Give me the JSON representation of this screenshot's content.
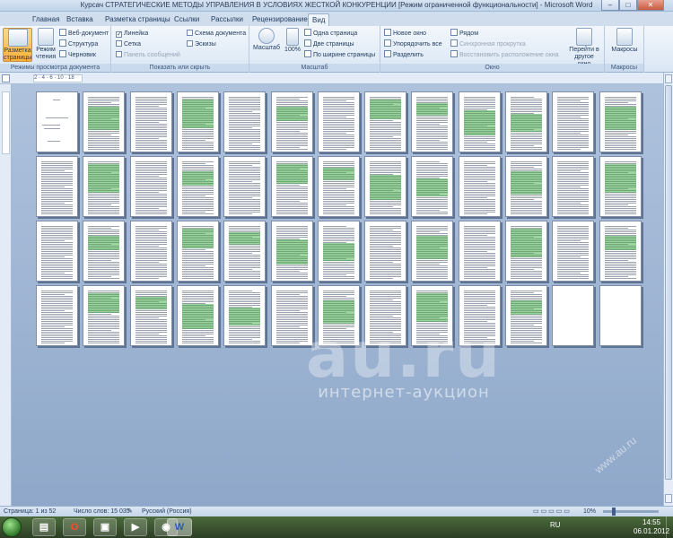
{
  "window": {
    "title": "Курсач СТРАТЕГИЧЕСКИЕ МЕТОДЫ УПРАВЛЕНИЯ В УСЛОВИЯХ ЖЕСТКОЙ КОНКУРЕНЦИИ [Режим ограниченной функциональности] - Microsoft Word",
    "minimize": "–",
    "maximize": "□",
    "close": "✕"
  },
  "tabs": [
    "Главная",
    "Вставка",
    "Разметка страницы",
    "Ссылки",
    "Рассылки",
    "Рецензирование",
    "Вид"
  ],
  "active_tab": "Вид",
  "ribbon": {
    "views_group": {
      "label": "Режимы просмотра документа",
      "print_layout": "Разметка страницы",
      "reading": "Режим чтения",
      "web": "Веб-документ",
      "outline": "Структура",
      "draft": "Черновик"
    },
    "show_group": {
      "label": "Показать или скрыть",
      "ruler": "Линейка",
      "ruler_checked": true,
      "grid": "Сетка",
      "message_bar": "Панель сообщений",
      "doc_map": "Схема документа",
      "thumbnails": "Эскизы"
    },
    "zoom_group": {
      "label": "Масштаб",
      "zoom": "Масштаб",
      "hundred": "100%",
      "one_page": "Одна страница",
      "two_pages": "Две страницы",
      "page_width": "По ширине страницы"
    },
    "window_group": {
      "label": "Окно",
      "new_window": "Новое окно",
      "arrange_all": "Упорядочить все",
      "split": "Разделить",
      "side_by_side": "Рядом",
      "sync_scroll": "Синхронная прокрутка",
      "reset_position": "Восстановить расположение окна",
      "switch_windows": "Перейти в другое окно"
    },
    "macros_group": {
      "label": "Макросы",
      "macros": "Макросы"
    }
  },
  "ruler": {
    "marks": "2 · 4 · 6 · 10 · 18"
  },
  "pages_total": 52,
  "status": {
    "page": "Страница: 1 из 52",
    "words": "Число слов: 15 035",
    "language": "Русский (Россия)",
    "zoom": "10%"
  },
  "taskbar": {
    "lang": "RU",
    "time": "14:55",
    "date": "06.01.2012"
  },
  "watermark": {
    "logo": "au.ru",
    "subtitle": "интернет-аукцион",
    "corner": "www.au.ru"
  }
}
